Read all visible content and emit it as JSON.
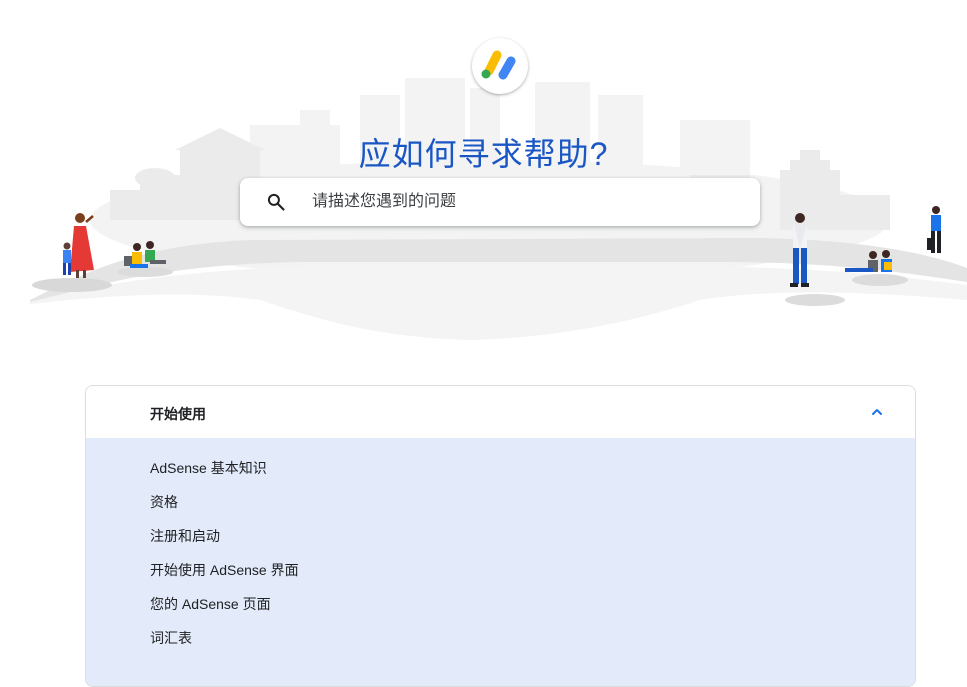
{
  "header": {
    "logo_icon": "adsense-logo-icon",
    "title": "应如何寻求帮助?"
  },
  "search": {
    "icon": "search-icon",
    "placeholder": "请描述您遇到的问题",
    "value": ""
  },
  "accordion": {
    "title": "开始使用",
    "expanded": true,
    "chevron_icon": "chevron-up-icon",
    "items": [
      {
        "label": "AdSense 基本知识"
      },
      {
        "label": "资格"
      },
      {
        "label": "注册和启动"
      },
      {
        "label": "开始使用 AdSense 界面"
      },
      {
        "label": "您的 AdSense 页面"
      },
      {
        "label": "词汇表"
      }
    ]
  },
  "colors": {
    "title_blue": "#1a56c4",
    "link_blue": "#1a73e8",
    "accordion_body": "#e3ebfa",
    "logo_yellow": "#fbbc04",
    "logo_green": "#34a853",
    "logo_blue": "#4285f4"
  }
}
